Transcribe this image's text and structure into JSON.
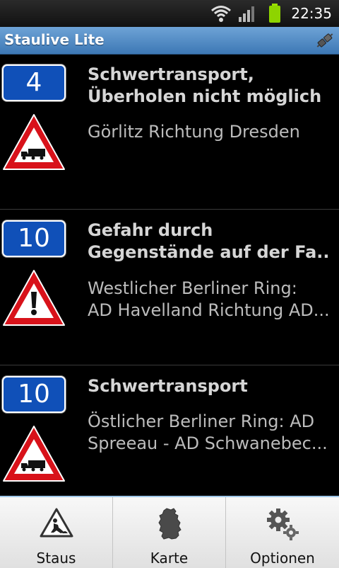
{
  "status_bar": {
    "time": "22:35"
  },
  "app": {
    "title": "Staulive Lite"
  },
  "incidents": [
    {
      "road": "4",
      "warning": "truck-warning-sign",
      "title": [
        "Schwertransport,",
        "Überholen nicht möglich"
      ],
      "location": [
        "Görlitz Richtung Dresden"
      ]
    },
    {
      "road": "10",
      "warning": "exclamation-warning-sign",
      "title": [
        "Gefahr durch",
        "Gegenstände auf der Fa..."
      ],
      "location": [
        "Westlicher Berliner Ring:",
        "AD Havelland Richtung AD..."
      ]
    },
    {
      "road": "10",
      "warning": "truck-warning-sign",
      "title": [
        "Schwertransport"
      ],
      "location": [
        "Östlicher Berliner Ring: AD",
        "Spreeau - AD Schwanebec..."
      ]
    }
  ],
  "tabs": [
    {
      "label": "Staus",
      "icon": "roadworks-icon"
    },
    {
      "label": "Karte",
      "icon": "germany-map-icon"
    },
    {
      "label": "Optionen",
      "icon": "gears-icon"
    }
  ],
  "colors": {
    "title_bar": "#4f8ccc",
    "road_sign": "#1050b8",
    "warning_red": "#d8121a"
  }
}
